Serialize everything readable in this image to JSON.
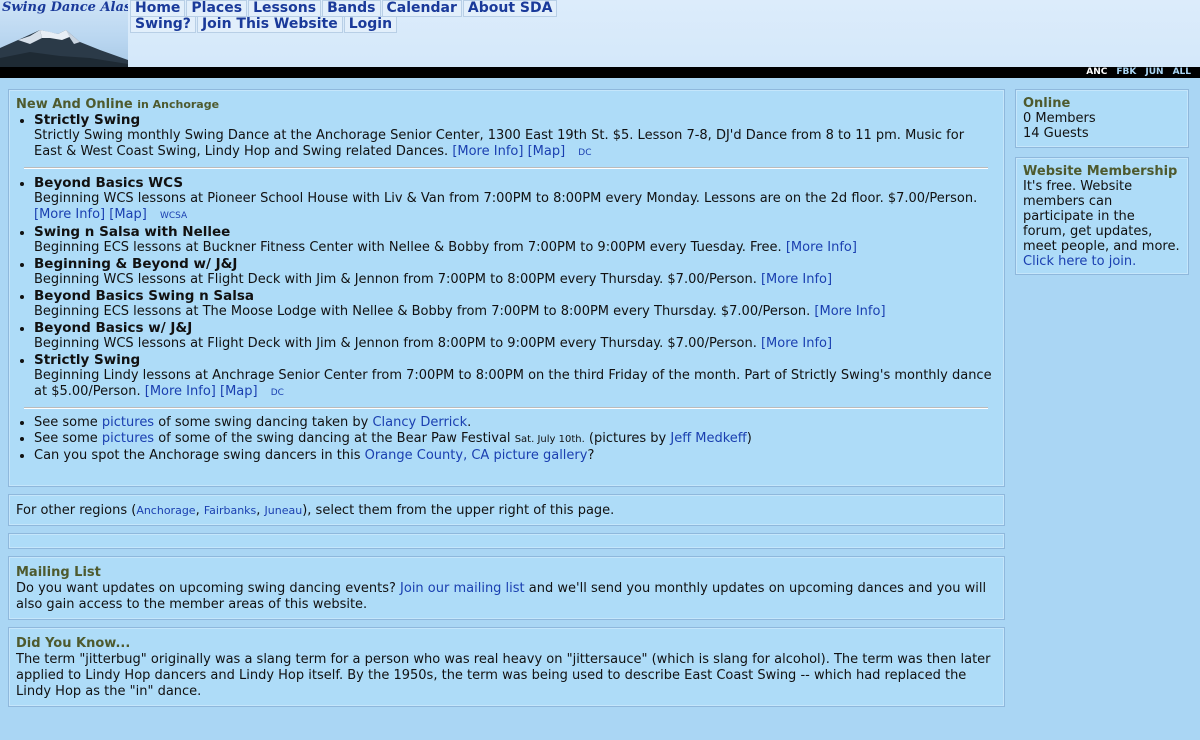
{
  "site": {
    "logo_text": "Swing Dance Alaska"
  },
  "nav": {
    "row1": [
      "Home",
      "Places",
      "Lessons",
      "Bands",
      "Calendar",
      "About SDA"
    ],
    "row2": [
      "Swing?",
      "Join This Website",
      "Login"
    ]
  },
  "regions": [
    "ANC",
    "FBK",
    "JUN",
    "ALL"
  ],
  "new_online": {
    "title": "New And Online",
    "subtitle": "in Anchorage",
    "featured": {
      "title": "Strictly Swing",
      "desc": "Strictly Swing monthly Swing Dance at the Anchorage Senior Center, 1300 East 19th St. $5. Lesson 7-8, DJ'd Dance from 8 to 11 pm. Music for East & West Coast Swing, Lindy Hop and Swing related Dances.",
      "more": "[More Info]",
      "map": "[Map]",
      "tag": "DC"
    },
    "lessons": [
      {
        "title": "Beyond Basics WCS",
        "desc": "Beginning WCS lessons at Pioneer School House with Liv & Van from 7:00PM to 8:00PM every Monday. Lessons are on the 2d floor. $7.00/Person.",
        "more": "[More Info]",
        "map": "[Map]",
        "tag": "WCSA"
      },
      {
        "title": "Swing n Salsa with Nellee",
        "desc": "Beginning ECS lessons at Buckner Fitness Center with Nellee & Bobby from 7:00PM to 9:00PM every Tuesday. Free.",
        "more": "[More Info]"
      },
      {
        "title": "Beginning & Beyond w/ J&J",
        "desc": "Beginning WCS lessons at Flight Deck with Jim & Jennon from 7:00PM to 8:00PM every Thursday. $7.00/Person.",
        "more": "[More Info]"
      },
      {
        "title": "Beyond Basics Swing n Salsa",
        "desc": "Beginning ECS lessons at The Moose Lodge with Nellee & Bobby from 7:00PM to 8:00PM every Thursday. $7.00/Person.",
        "more": "[More Info]"
      },
      {
        "title": "Beyond Basics w/ J&J",
        "desc": "Beginning WCS lessons at Flight Deck with Jim & Jennon from 8:00PM to 9:00PM every Thursday. $7.00/Person.",
        "more": "[More Info]"
      },
      {
        "title": "Strictly Swing",
        "desc": "Beginning Lindy lessons at Anchrage Senior Center from 7:00PM to 8:00PM on the third Friday of the month. Part of Strictly Swing's monthly dance at $5.00/Person.",
        "more": "[More Info]",
        "map": "[Map]",
        "tag": "DC"
      }
    ],
    "pictures": {
      "p1_pre": "See some ",
      "p1_link": "pictures",
      "p1_mid": " of some swing dancing taken by ",
      "p1_author": "Clancy Derrick",
      "p1_end": ".",
      "p2_pre": "See some ",
      "p2_link": "pictures",
      "p2_mid": " of some of the swing dancing at the Bear Paw Festival ",
      "p2_date": "Sat. July 10th.",
      "p2_mid2": " (pictures by ",
      "p2_author": "Jeff Medkeff",
      "p2_end": ")",
      "p3_pre": "Can you spot the Anchorage swing dancers in this ",
      "p3_link": "Orange County, CA picture gallery",
      "p3_end": "?"
    }
  },
  "other_regions": {
    "pre": "For other regions (",
    "links": [
      "Anchorage",
      "Fairbanks",
      "Juneau"
    ],
    "post": "), select them from the upper right of this page."
  },
  "mailing": {
    "title": "Mailing List",
    "pre": "Do you want updates on upcoming swing dancing events? ",
    "link": "Join our mailing list",
    "post": " and we'll send you monthly updates on upcoming dances and you will also gain access to the member areas of this website."
  },
  "did_you_know": {
    "title": "Did You Know...",
    "text": "The term \"jitterbug\" originally was a slang term for a person who was real heavy on \"jittersauce\" (which is slang for alcohol). The term was then later applied to Lindy Hop dancers and Lindy Hop itself. By the 1950s, the term was being used to describe East Coast Swing -- which had replaced the Lindy Hop as the \"in\" dance."
  },
  "online": {
    "title": "Online",
    "members": "0 Members",
    "guests": "14 Guests"
  },
  "membership": {
    "title": "Website Membership",
    "text": "It's free. Website members can participate in the forum, get updates, meet people, and more. ",
    "link": "Click here to join."
  }
}
